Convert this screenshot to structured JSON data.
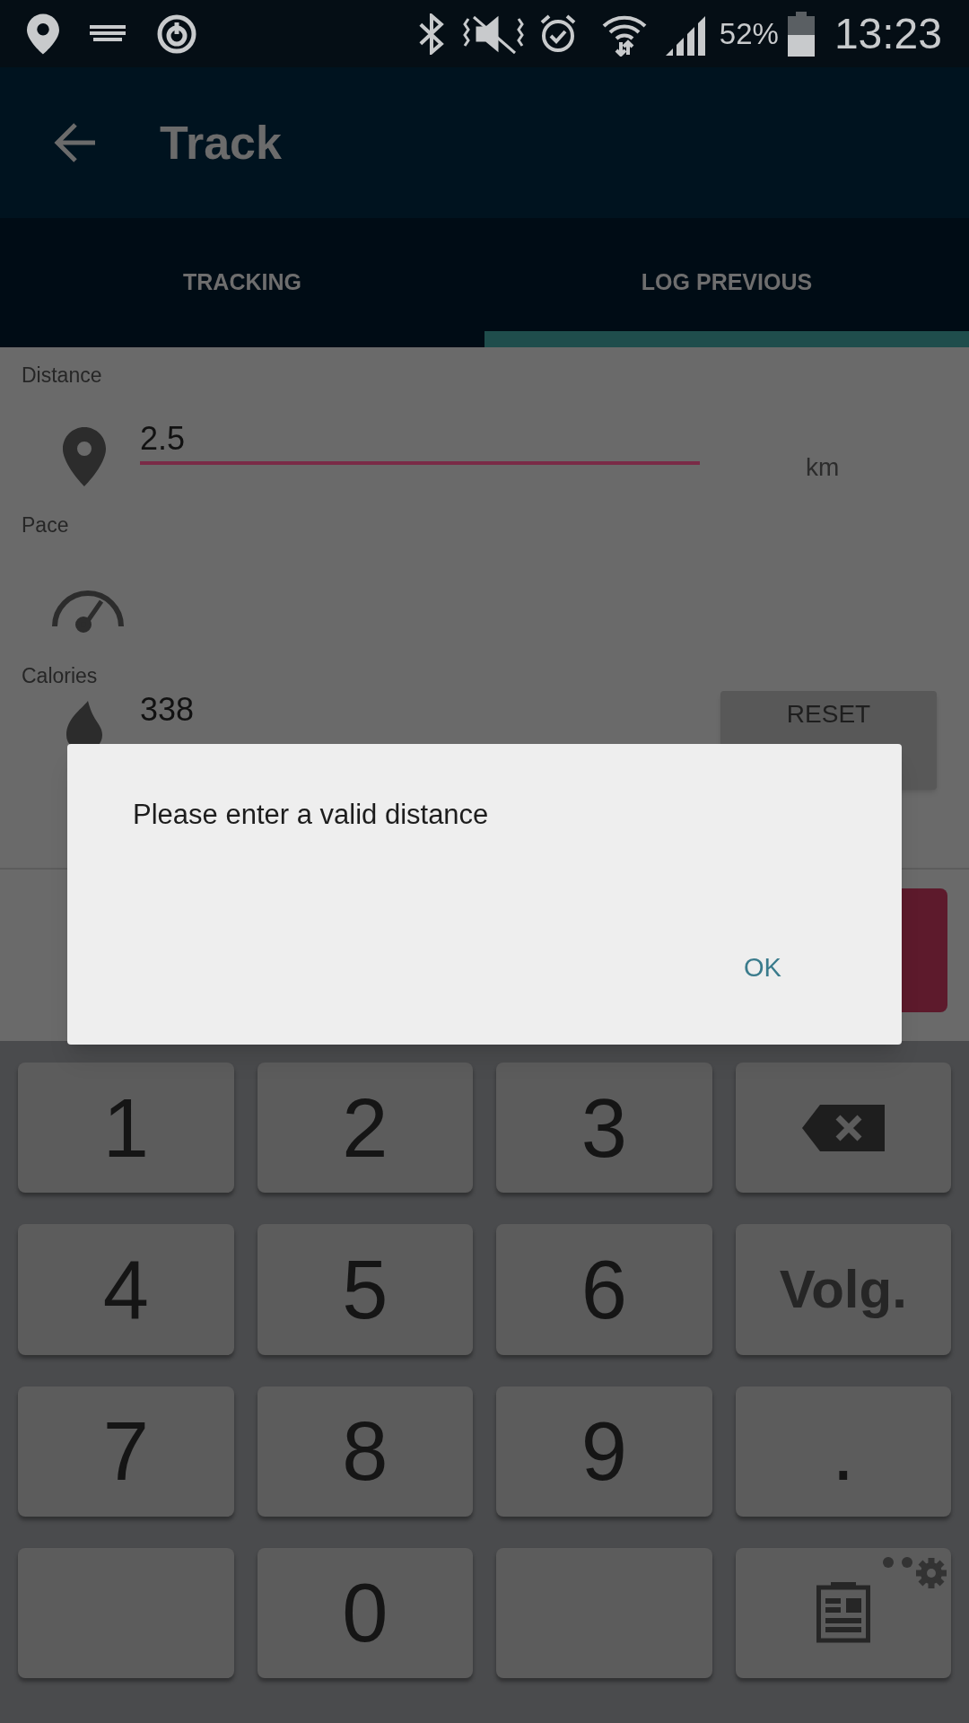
{
  "status_bar": {
    "battery": "52%",
    "time": "13:23"
  },
  "app_bar": {
    "title": "Track"
  },
  "tabs": [
    {
      "label": "TRACKING",
      "selected": false
    },
    {
      "label": "LOG PREVIOUS",
      "selected": true
    }
  ],
  "form": {
    "distance": {
      "label": "Distance",
      "value": "2.5",
      "unit": "km",
      "error": true
    },
    "pace": {
      "label": "Pace"
    },
    "calories": {
      "label": "Calories",
      "value": "338"
    },
    "reset_button": "RESET"
  },
  "dialog": {
    "message": "Please enter a valid distance",
    "button": "OK"
  },
  "keyboard": [
    {
      "kind": "digit",
      "label": "1"
    },
    {
      "kind": "digit",
      "label": "2"
    },
    {
      "kind": "digit",
      "label": "3"
    },
    {
      "kind": "backspace"
    },
    {
      "kind": "digit",
      "label": "4"
    },
    {
      "kind": "digit",
      "label": "5"
    },
    {
      "kind": "digit",
      "label": "6"
    },
    {
      "kind": "text",
      "label": "Volg."
    },
    {
      "kind": "digit",
      "label": "7"
    },
    {
      "kind": "digit",
      "label": "8"
    },
    {
      "kind": "digit",
      "label": "9"
    },
    {
      "kind": "digit",
      "label": "."
    },
    {
      "kind": "blank"
    },
    {
      "kind": "digit",
      "label": "0"
    },
    {
      "kind": "blank"
    },
    {
      "kind": "clipboard"
    }
  ]
}
